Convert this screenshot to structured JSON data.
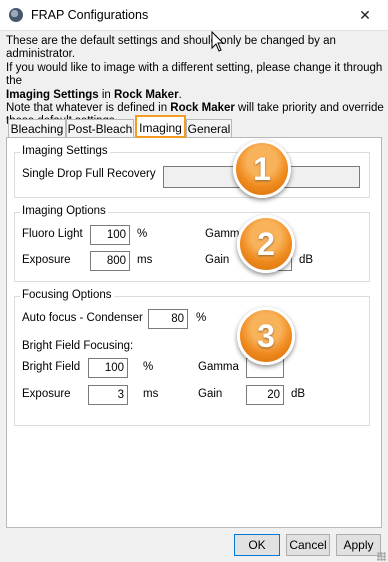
{
  "window": {
    "title": "FRAP Configurations",
    "close_glyph": "✕",
    "app_icon": "rock-maker-icon"
  },
  "intro": {
    "line1": "These are the default settings and should only be changed by an administrator.",
    "line2": "If you would like to image with a different setting, please change it through the",
    "line3_bold1": "Imaging Settings",
    "line3_mid": " in ",
    "line3_bold2": "Rock Maker",
    "line3_end": ".",
    "line4_start": "Note that whatever is defined in ",
    "line4_bold": "Rock Maker",
    "line4_end": " will take priority and override",
    "line5": "these default settings."
  },
  "tabs": [
    {
      "label": "Bleaching"
    },
    {
      "label": "Post-Bleach"
    },
    {
      "label": "Imaging",
      "selected": true
    },
    {
      "label": "General"
    }
  ],
  "imaging_settings": {
    "title": "Imaging Settings",
    "single_drop_label": "Single Drop Full Recovery"
  },
  "imaging_options": {
    "title": "Imaging Options",
    "fluoro_label": "Fluoro Light",
    "fluoro_value": "100",
    "fluoro_unit": "%",
    "gamma_label": "Gamma",
    "exposure_label": "Exposure",
    "exposure_value": "800",
    "exposure_unit": "ms",
    "gain_label": "Gain",
    "gain_unit": "dB"
  },
  "focusing_options": {
    "title": "Focusing Options",
    "autofocus_label": "Auto focus - Condenser",
    "autofocus_value": "80",
    "autofocus_unit": "%",
    "bright_field_heading": "Bright Field Focusing:",
    "bright_field_label": "Bright Field",
    "bright_field_value": "100",
    "bright_field_unit": "%",
    "gamma_label": "Gamma",
    "exposure_label": "Exposure",
    "exposure_value": "3",
    "exposure_unit": "ms",
    "gain_label": "Gain",
    "gain_value": "20",
    "gain_unit": "dB"
  },
  "callouts": [
    "1",
    "2",
    "3"
  ],
  "callout_color": "#ef8a1e",
  "tab_highlight_color": "#f39c21",
  "buttons": {
    "ok": "OK",
    "cancel": "Cancel",
    "apply": "Apply"
  }
}
